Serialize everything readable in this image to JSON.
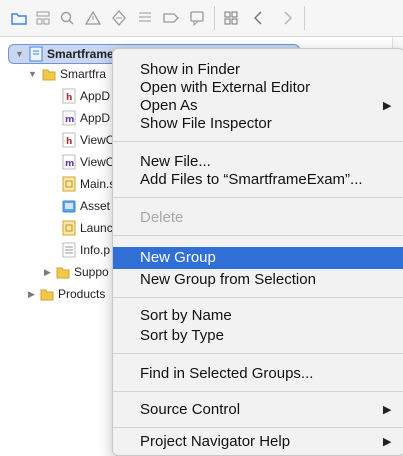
{
  "toolbar": {
    "icons": [
      "folder-icon",
      "hierarchy-icon",
      "search-icon",
      "warning-icon",
      "test-icon",
      "list-icon",
      "tag-icon",
      "comment-icon",
      "grid-icon",
      "chevron-left-icon",
      "chevron-right-icon"
    ]
  },
  "navigator": {
    "root": "Smartframe",
    "group": "Smartfra",
    "files": [
      {
        "label": "AppD",
        "badge": "h"
      },
      {
        "label": "AppD",
        "badge": "m"
      },
      {
        "label": "ViewC",
        "badge": "h"
      },
      {
        "label": "ViewC",
        "badge": "m"
      },
      {
        "label": "Main.s",
        "badge": "sb"
      },
      {
        "label": "Asset",
        "badge": "as"
      },
      {
        "label": "Launc",
        "badge": "sb"
      },
      {
        "label": "Info.p",
        "badge": "pl"
      }
    ],
    "supp": "Suppo",
    "products": "Products"
  },
  "menu": {
    "show_in_finder": "Show in Finder",
    "open_external": "Open with External Editor",
    "open_as": "Open As",
    "show_inspector": "Show File Inspector",
    "new_file": "New File...",
    "add_files": "Add Files to “SmartframeExam”...",
    "delete": "Delete",
    "new_group": "New Group",
    "new_group_selection": "New Group from Selection",
    "sort_name": "Sort by Name",
    "sort_type": "Sort by Type",
    "find_groups": "Find in Selected Groups...",
    "source_control": "Source Control",
    "nav_help": "Project Navigator Help",
    "submenu_arrow": "▶"
  }
}
